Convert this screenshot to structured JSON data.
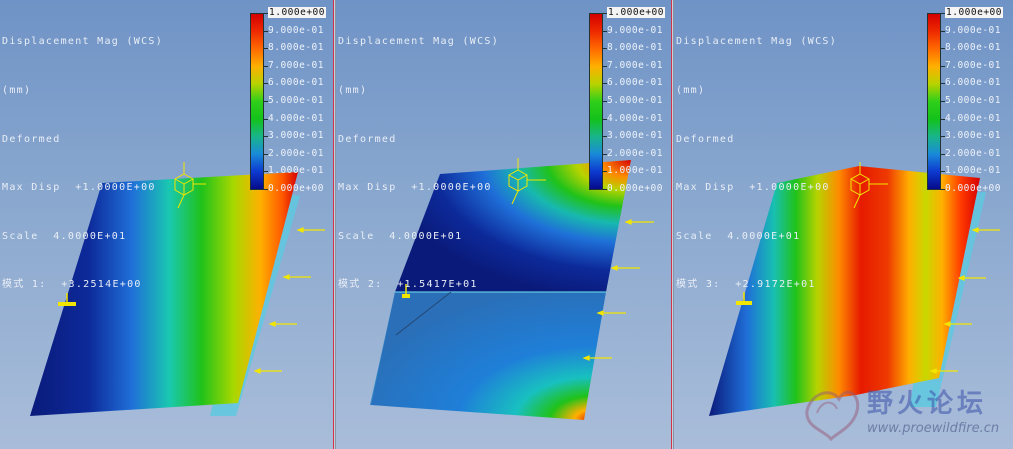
{
  "viewports": [
    {
      "title": "Displacement Mag (WCS)",
      "units": "(mm)",
      "deformed": "Deformed",
      "max_disp": "Max Disp  +1.0000E+00",
      "scale": "Scale  4.0000E+01",
      "mode": "模式 1:  +3.2514E+00"
    },
    {
      "title": "Displacement Mag (WCS)",
      "units": "(mm)",
      "deformed": "Deformed",
      "max_disp": "Max Disp  +1.0000E+00",
      "scale": "Scale  4.0000E+01",
      "mode": "模式 2:  +1.5417E+01"
    },
    {
      "title": "Displacement Mag (WCS)",
      "units": "(mm)",
      "deformed": "Deformed",
      "max_disp": "Max Disp  +1.0000E+00",
      "scale": "Scale  4.0000E+01",
      "mode": "模式 3:  +2.9172E+01"
    }
  ],
  "legend_labels": [
    "1.000e+00",
    "9.000e-01",
    "8.000e-01",
    "7.000e-01",
    "6.000e-01",
    "5.000e-01",
    "4.000e-01",
    "3.000e-01",
    "2.000e-01",
    "1.000e-01",
    "0.000e+00"
  ],
  "colors": {
    "background_top": "#6f93c6",
    "background_bottom": "#a9bdd9",
    "divider_accent": "#d2334a",
    "load_arrow": "#f2e600",
    "flat_plate": "#5fc8e0"
  },
  "watermark": {
    "chinese": "野火论坛",
    "url": "www.proewildfire.cn"
  }
}
